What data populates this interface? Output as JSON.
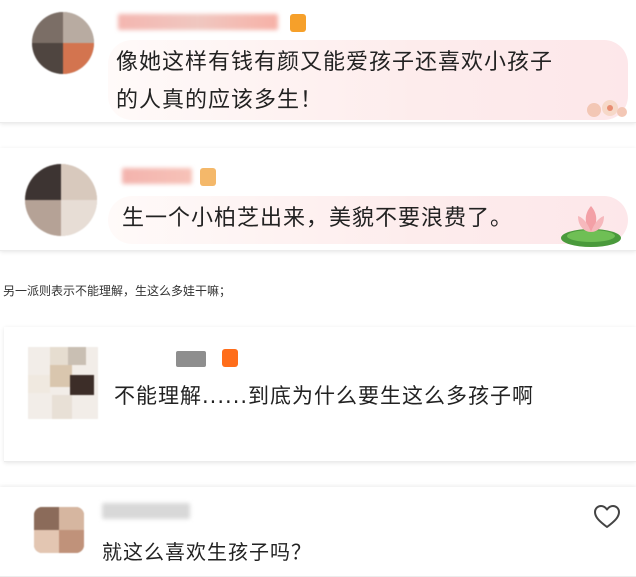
{
  "comments": [
    {
      "text_line1": "像她这样有钱有颜又能爱孩子还喜欢小孩子",
      "text_line2": "的人真的应该多生！"
    },
    {
      "text": "生一个小柏芝出来，美貌不要浪费了。"
    },
    {
      "text": "不能理解......到底为什么要生这么多孩子啊"
    },
    {
      "text": "就这么喜欢生孩子吗？"
    }
  ],
  "caption": "另一派则表示不能理解，生这么多娃干嘛；",
  "icons": {
    "lotus": "lotus-sticker-icon",
    "heart": "heart-outline-icon",
    "flower": "flower-decoration-icon"
  },
  "colors": {
    "bubble_pink": "#fde7ea",
    "vip_orange": "#f6a02a",
    "text": "#222222"
  }
}
